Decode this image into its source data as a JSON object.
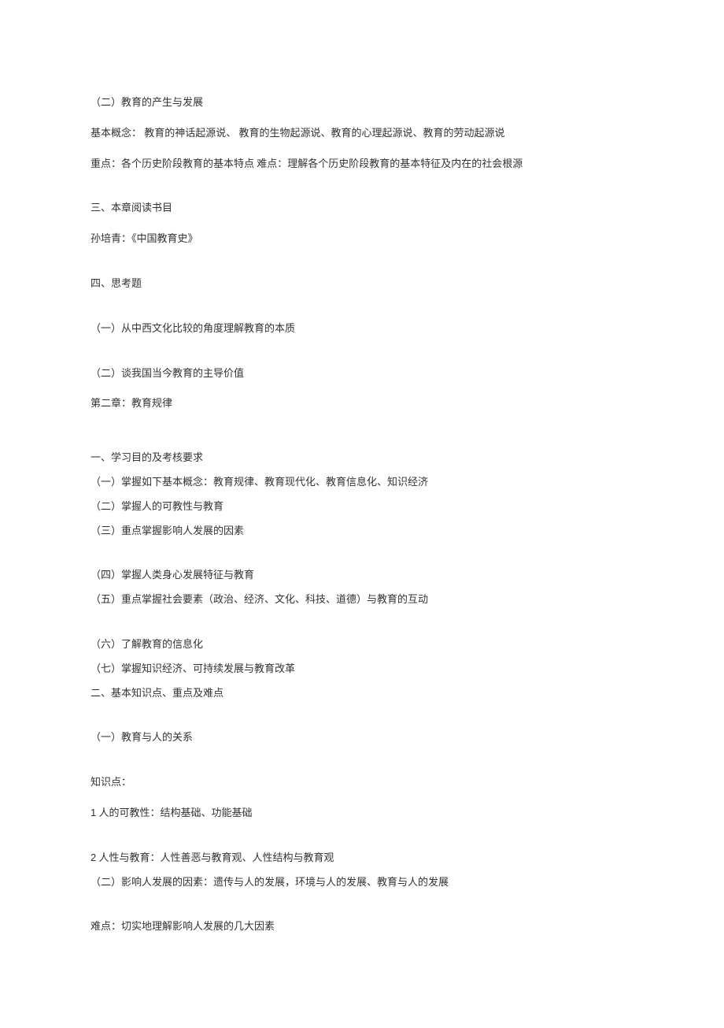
{
  "lines": {
    "l1": "（二）教育的产生与发展",
    "l2": "基本概念：  教育的神话起源说、  教育的生物起源说、教育的心理起源说、教育的劳动起源说",
    "l3": "重点：各个历史阶段教育的基本特点 难点：理解各个历史阶段教育的基本特征及内在的社会根源",
    "l4": "三、本章阅读书目",
    "l5": "孙培青：《中国教育史》",
    "l6": "四、思考题",
    "l7": "（一）从中西文化比较的角度理解教育的本质",
    "l8": "（二）谈我国当今教育的主导价值",
    "l9": "第二章：教育规律",
    "l10": "一、学习目的及考核要求",
    "l11": "（一）掌握如下基本概念：教育规律、教育现代化、教育信息化、知识经济",
    "l12": "（二）掌握人的可教性与教育",
    "l13": "（三）重点掌握影响人发展的因素",
    "l14": "（四）掌握人类身心发展特征与教育",
    "l15": "（五）重点掌握社会要素（政治、经济、文化、科技、道德）与教育的互动",
    "l16": "（六）了解教育的信息化",
    "l17": "（七）掌握知识经济、可持续发展与教育改革",
    "l18": "二、基本知识点、重点及难点",
    "l19": "（一）教育与人的关系",
    "l20": "知识点：",
    "l21_num": "1",
    "l21_text": "  人的可教性：结构基础、功能基础",
    "l22_num": "2",
    "l22_text": "  人性与教育：人性善恶与教育观、人性结构与教育观",
    "l23": "（二）影响人发展的因素：遗传与人的发展，环境与人的发展、教育与人的发展",
    "l24": "难点：切实地理解影响人发展的几大因素"
  }
}
